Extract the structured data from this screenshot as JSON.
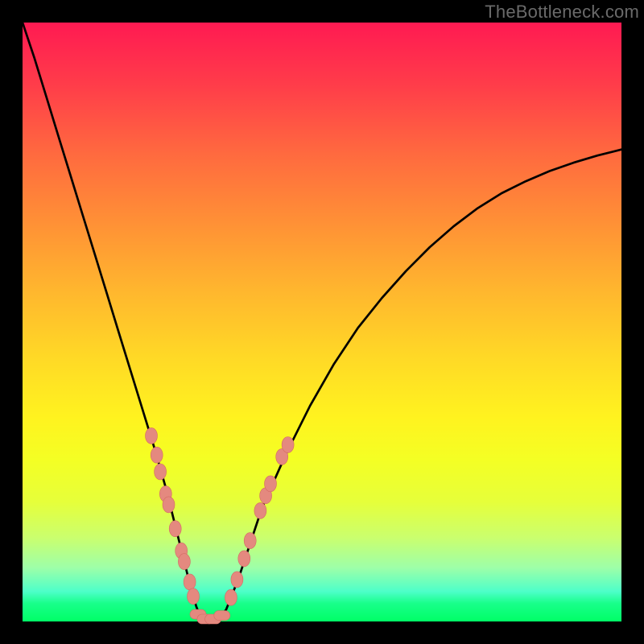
{
  "watermark": {
    "text": "TheBottleneck.com"
  },
  "colors": {
    "frame": "#000000",
    "curve": "#000000",
    "marker_fill": "#e4897f",
    "marker_stroke": "#d46a63"
  },
  "chart_data": {
    "type": "line",
    "title": "",
    "xlabel": "",
    "ylabel": "",
    "xlim": [
      0,
      100
    ],
    "ylim": [
      0,
      100
    ],
    "x": [
      0,
      2,
      4,
      6,
      8,
      10,
      12,
      14,
      16,
      18,
      20,
      22,
      24,
      25.5,
      27,
      28,
      29,
      30,
      31,
      32.5,
      34,
      36,
      38,
      40,
      44,
      48,
      52,
      56,
      60,
      64,
      68,
      72,
      76,
      80,
      84,
      88,
      92,
      96,
      100
    ],
    "series": [
      {
        "name": "bottleneck-curve",
        "values": [
          100,
          94,
          87.5,
          81,
          74.5,
          68,
          61.5,
          55,
          48.5,
          42,
          35.5,
          29,
          22,
          16,
          10,
          6,
          2.5,
          0,
          0,
          0,
          2,
          7,
          13,
          19,
          28,
          36,
          43,
          49,
          54,
          58.5,
          62.5,
          66,
          69,
          71.5,
          73.5,
          75.2,
          76.6,
          77.8,
          78.8
        ]
      }
    ],
    "markers": [
      {
        "x": 21.5,
        "y": 31.0,
        "shape": "ellipse"
      },
      {
        "x": 22.4,
        "y": 27.8,
        "shape": "ellipse"
      },
      {
        "x": 23.0,
        "y": 25.0,
        "shape": "ellipse"
      },
      {
        "x": 23.9,
        "y": 21.3,
        "shape": "ellipse"
      },
      {
        "x": 24.4,
        "y": 19.5,
        "shape": "ellipse"
      },
      {
        "x": 25.5,
        "y": 15.5,
        "shape": "ellipse"
      },
      {
        "x": 26.5,
        "y": 11.8,
        "shape": "ellipse"
      },
      {
        "x": 27.0,
        "y": 10.0,
        "shape": "ellipse"
      },
      {
        "x": 27.9,
        "y": 6.6,
        "shape": "ellipse"
      },
      {
        "x": 28.5,
        "y": 4.2,
        "shape": "ellipse"
      },
      {
        "x": 29.3,
        "y": 1.2,
        "shape": "pill"
      },
      {
        "x": 30.5,
        "y": 0.4,
        "shape": "pill"
      },
      {
        "x": 31.8,
        "y": 0.4,
        "shape": "pill"
      },
      {
        "x": 33.3,
        "y": 1.0,
        "shape": "pill"
      },
      {
        "x": 34.8,
        "y": 4.0,
        "shape": "ellipse"
      },
      {
        "x": 35.8,
        "y": 7.0,
        "shape": "ellipse"
      },
      {
        "x": 37.0,
        "y": 10.5,
        "shape": "ellipse"
      },
      {
        "x": 38.0,
        "y": 13.5,
        "shape": "ellipse"
      },
      {
        "x": 39.7,
        "y": 18.5,
        "shape": "ellipse"
      },
      {
        "x": 40.6,
        "y": 21.0,
        "shape": "ellipse"
      },
      {
        "x": 41.4,
        "y": 23.0,
        "shape": "ellipse"
      },
      {
        "x": 43.3,
        "y": 27.5,
        "shape": "ellipse"
      },
      {
        "x": 44.3,
        "y": 29.5,
        "shape": "ellipse"
      }
    ],
    "legend": null,
    "grid": false
  }
}
